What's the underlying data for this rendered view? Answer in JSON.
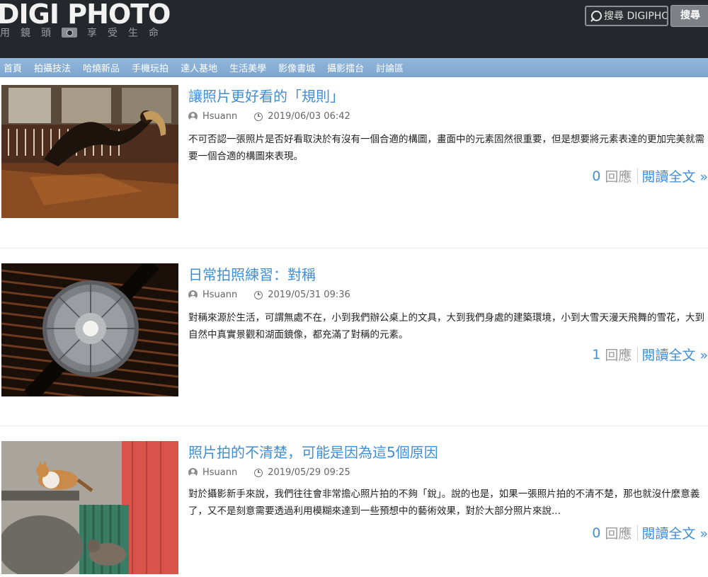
{
  "header": {
    "logo": "DIGI PHOTO",
    "tagline": [
      "用",
      "鏡",
      "頭",
      "享",
      "受",
      "生",
      "命"
    ],
    "search_placeholder": "搜尋 DIGIPHOTO",
    "search_button": "搜尋"
  },
  "nav": {
    "items": [
      "首頁",
      "拍攝技法",
      "哈燒新品",
      "手機玩拍",
      "達人基地",
      "生活美學",
      "影像書城",
      "攝影擂台",
      "討論區"
    ]
  },
  "posts": [
    {
      "title": "讓照片更好看的「規則」",
      "author": "Hsuann",
      "datetime": "2019/06/03 06:42",
      "excerpt": "不可否認一張照片是否好看取決於有沒有一個合適的構圖，畫面中的元素固然很重要，但是想要將元素表達的更加完美就需要一個合適的構圖來表現。",
      "reply_count": "0",
      "reply_label": "回應",
      "read_more": "閱讀全文 »"
    },
    {
      "title": "日常拍照練習：對稱",
      "author": "Hsuann",
      "datetime": "2019/05/31 09:36",
      "excerpt": "對稱來源於生活，可謂無處不在，小到我們辦公桌上的文具，大到我們身處的建築環境，小到大雪天漫天飛舞的雪花，大到自然中真實景觀和湖面鏡像，都充滿了對稱的元素。",
      "reply_count": "1",
      "reply_label": "回應",
      "read_more": "閱讀全文 »"
    },
    {
      "title": "照片拍的不清楚，可能是因為這5個原因",
      "author": "Hsuann",
      "datetime": "2019/05/29 09:25",
      "excerpt": "對於攝影新手來說，我們往往會非常擔心照片拍的不夠「銳」。說的也是，如果一張照片拍的不清不楚，那也就沒什麼意義了，又不是刻意需要透過利用模糊來達到一些預想中的藝術效果，對於大部分照片來說...",
      "reply_count": "0",
      "reply_label": "回應",
      "read_more": "閱讀全文 »"
    }
  ],
  "colors": {
    "header_bg": "#24272b",
    "nav_bg": "#86acd4",
    "link_blue": "#3f8ed6"
  }
}
